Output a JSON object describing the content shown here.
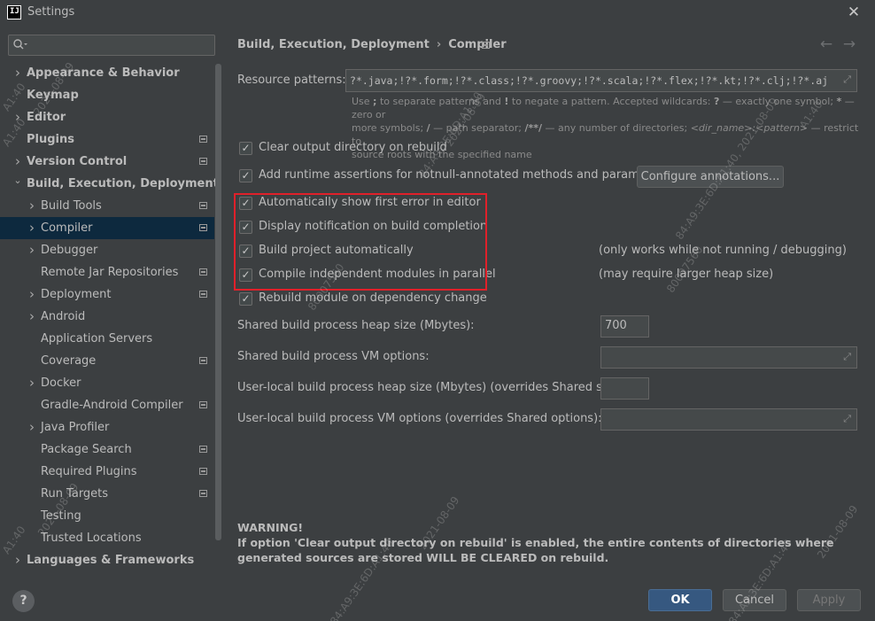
{
  "window": {
    "title": "Settings",
    "app_icon": "IJ"
  },
  "sidebar": {
    "search_placeholder": "",
    "items": [
      {
        "label": "Appearance & Behavior",
        "level": 0,
        "arrow": "collapsed",
        "bold": true,
        "project_icon": false
      },
      {
        "label": "Keymap",
        "level": 0,
        "arrow": "none",
        "bold": true,
        "project_icon": false
      },
      {
        "label": "Editor",
        "level": 0,
        "arrow": "collapsed",
        "bold": true,
        "project_icon": false
      },
      {
        "label": "Plugins",
        "level": 0,
        "arrow": "none",
        "bold": true,
        "project_icon": true
      },
      {
        "label": "Version Control",
        "level": 0,
        "arrow": "collapsed",
        "bold": true,
        "project_icon": true
      },
      {
        "label": "Build, Execution, Deployment",
        "level": 0,
        "arrow": "expanded",
        "bold": true,
        "project_icon": false
      },
      {
        "label": "Build Tools",
        "level": 1,
        "arrow": "collapsed",
        "bold": false,
        "project_icon": true
      },
      {
        "label": "Compiler",
        "level": 1,
        "arrow": "collapsed",
        "bold": false,
        "project_icon": true,
        "selected": true
      },
      {
        "label": "Debugger",
        "level": 1,
        "arrow": "collapsed",
        "bold": false,
        "project_icon": false
      },
      {
        "label": "Remote Jar Repositories",
        "level": 1,
        "arrow": "none",
        "bold": false,
        "project_icon": true
      },
      {
        "label": "Deployment",
        "level": 1,
        "arrow": "collapsed",
        "bold": false,
        "project_icon": true
      },
      {
        "label": "Android",
        "level": 1,
        "arrow": "collapsed",
        "bold": false,
        "project_icon": false
      },
      {
        "label": "Application Servers",
        "level": 1,
        "arrow": "none",
        "bold": false,
        "project_icon": false
      },
      {
        "label": "Coverage",
        "level": 1,
        "arrow": "none",
        "bold": false,
        "project_icon": true
      },
      {
        "label": "Docker",
        "level": 1,
        "arrow": "collapsed",
        "bold": false,
        "project_icon": false
      },
      {
        "label": "Gradle-Android Compiler",
        "level": 1,
        "arrow": "none",
        "bold": false,
        "project_icon": true
      },
      {
        "label": "Java Profiler",
        "level": 1,
        "arrow": "collapsed",
        "bold": false,
        "project_icon": false
      },
      {
        "label": "Package Search",
        "level": 1,
        "arrow": "none",
        "bold": false,
        "project_icon": true
      },
      {
        "label": "Required Plugins",
        "level": 1,
        "arrow": "none",
        "bold": false,
        "project_icon": true
      },
      {
        "label": "Run Targets",
        "level": 1,
        "arrow": "none",
        "bold": false,
        "project_icon": true
      },
      {
        "label": "Testing",
        "level": 1,
        "arrow": "none",
        "bold": false,
        "project_icon": false
      },
      {
        "label": "Trusted Locations",
        "level": 1,
        "arrow": "none",
        "bold": false,
        "project_icon": false
      },
      {
        "label": "Languages & Frameworks",
        "level": 0,
        "arrow": "collapsed",
        "bold": true,
        "project_icon": false
      }
    ]
  },
  "breadcrumb": {
    "parent": "Build, Execution, Deployment",
    "separator": "›",
    "current": "Compiler"
  },
  "compiler": {
    "resource_patterns_label": "Resource patterns:",
    "resource_patterns_value": "?*.java;!?*.form;!?*.class;!?*.groovy;!?*.scala;!?*.flex;!?*.kt;!?*.clj;!?*.aj",
    "hint_line1_a": "Use ",
    "hint_line1_b": ";",
    "hint_line1_c": " to separate patterns and ",
    "hint_line1_d": "!",
    "hint_line1_e": " to negate a pattern. Accepted wildcards: ",
    "hint_line1_f": "?",
    "hint_line1_g": " — exactly one symbol; ",
    "hint_line1_h": "*",
    "hint_line1_i": " — zero or",
    "hint_line2_a": "more symbols; ",
    "hint_line2_b": "/",
    "hint_line2_c": " — path separator; ",
    "hint_line2_d": "/**/",
    "hint_line2_e": " — any number of directories; ",
    "hint_line2_f": "<dir_name>:<pattern>",
    "hint_line2_g": " — restrict to",
    "hint_line3": "source roots with the specified name",
    "checkboxes": [
      {
        "label": "Clear output directory on rebuild",
        "checked": true
      },
      {
        "label": "Add runtime assertions for notnull-annotated methods and parameters",
        "checked": true
      },
      {
        "label": "Automatically show first error in editor",
        "checked": true
      },
      {
        "label": "Display notification on build completion",
        "checked": true
      },
      {
        "label": "Build project automatically",
        "checked": true
      },
      {
        "label": "Compile independent modules in parallel",
        "checked": true
      },
      {
        "label": "Rebuild module on dependency change",
        "checked": true
      }
    ],
    "configure_annotations_label": "Configure annotations...",
    "note_build_auto": "(only works while not running / debugging)",
    "note_parallel": "(may require larger heap size)",
    "heap_size_label": "Shared build process heap size (Mbytes):",
    "heap_size_value": "700",
    "vm_options_label": "Shared build process VM options:",
    "vm_options_value": "",
    "user_heap_label": "User-local build process heap size (Mbytes) (overrides Shared size):",
    "user_heap_value": "",
    "user_vm_label": "User-local build process VM options (overrides Shared options):",
    "user_vm_value": "",
    "warning_title": "WARNING!",
    "warning_text": "If option 'Clear output directory on rebuild' is enabled, the entire contents of directories where generated sources are stored WILL BE CLEARED on rebuild."
  },
  "footer": {
    "help_label": "?",
    "ok_label": "OK",
    "cancel_label": "Cancel",
    "apply_label": "Apply"
  },
  "watermarks": {
    "a": "A1:40",
    "b": "2021-08-09",
    "c": "84:A9:3E:6D:A1:40",
    "d": "80007560",
    "e": "84:A9:3E:6D:A1:40, 2021-08-09"
  },
  "colors": {
    "background": "#3c3f41",
    "selection": "#0d293e",
    "accent_button": "#365880",
    "highlight_box": "#e0202a"
  }
}
